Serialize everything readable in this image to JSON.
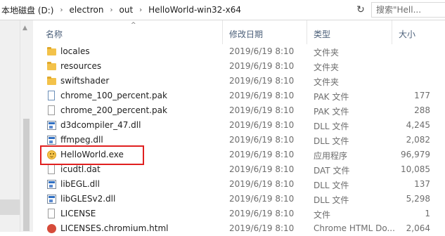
{
  "address": {
    "crumbs": [
      "本地磁盘 (D:)",
      "electron",
      "out",
      "HelloWorld-win32-x64"
    ],
    "separator": "›",
    "dropdown_glyph": "⌄",
    "refresh_glyph": "↻",
    "search_placeholder": "搜索\"Hell..."
  },
  "columns": {
    "name": "名称",
    "date": "修改日期",
    "type": "类型",
    "size": "大小",
    "sort_glyph": "^"
  },
  "files": [
    {
      "name": "locales",
      "date": "2019/6/19 8:10",
      "type": "文件夹",
      "size": "",
      "icon": "folder-icon"
    },
    {
      "name": "resources",
      "date": "2019/6/19 8:10",
      "type": "文件夹",
      "size": "",
      "icon": "folder-icon"
    },
    {
      "name": "swiftshader",
      "date": "2019/6/19 8:10",
      "type": "文件夹",
      "size": "",
      "icon": "folder-icon"
    },
    {
      "name": "chrome_100_percent.pak",
      "date": "2019/6/19 8:10",
      "type": "PAK 文件",
      "size": "177",
      "icon": "pak-file-icon"
    },
    {
      "name": "chrome_200_percent.pak",
      "date": "2019/6/19 8:10",
      "type": "PAK 文件",
      "size": "288",
      "icon": "file-icon"
    },
    {
      "name": "d3dcompiler_47.dll",
      "date": "2019/6/19 8:10",
      "type": "DLL 文件",
      "size": "4,245",
      "icon": "dll-icon"
    },
    {
      "name": "ffmpeg.dll",
      "date": "2019/6/19 8:10",
      "type": "DLL 文件",
      "size": "2,082",
      "icon": "dll-icon"
    },
    {
      "name": "HelloWorld.exe",
      "date": "2019/6/19 8:10",
      "type": "应用程序",
      "size": "96,979",
      "icon": "smiley-app-icon"
    },
    {
      "name": "icudtl.dat",
      "date": "2019/6/19 8:10",
      "type": "DAT 文件",
      "size": "10,085",
      "icon": "file-icon"
    },
    {
      "name": "libEGL.dll",
      "date": "2019/6/19 8:10",
      "type": "DLL 文件",
      "size": "137",
      "icon": "dll-icon"
    },
    {
      "name": "libGLESv2.dll",
      "date": "2019/6/19 8:10",
      "type": "DLL 文件",
      "size": "5,298",
      "icon": "dll-icon"
    },
    {
      "name": "LICENSE",
      "date": "2019/6/19 8:10",
      "type": "文件",
      "size": "1",
      "icon": "file-icon"
    },
    {
      "name": "LICENSES.chromium.html",
      "date": "2019/6/19 8:10",
      "type": "Chrome HTML Do...",
      "size": "2,064",
      "icon": "chrome-html-icon"
    }
  ],
  "highlight_color": "#e02020"
}
